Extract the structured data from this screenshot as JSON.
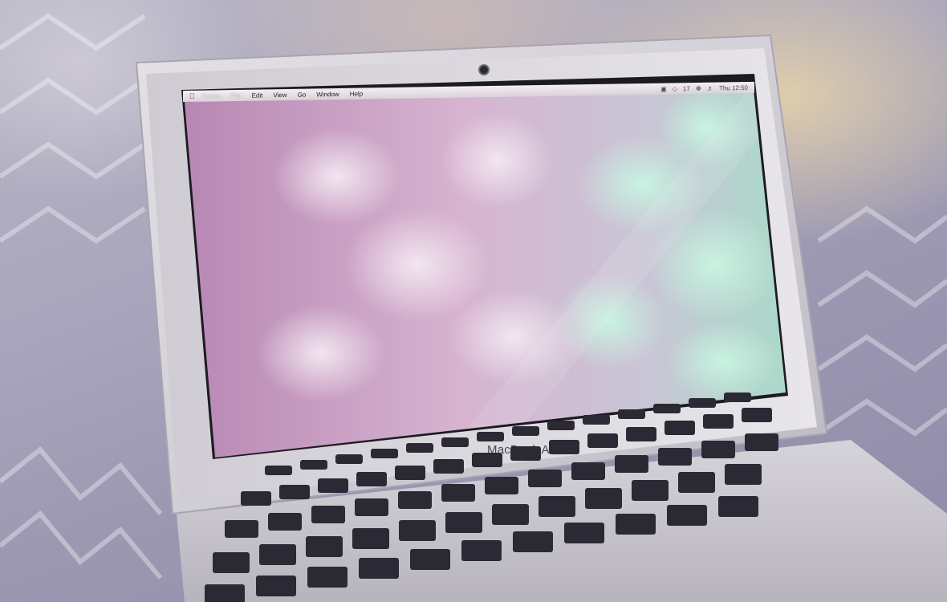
{
  "menubar": {
    "items": [
      "Edit",
      "View",
      "Go",
      "Window",
      "Help"
    ],
    "status_number": "17",
    "clock": "Thu 12:50"
  },
  "brand": "MacBook Air",
  "colors": {
    "wallpaper_pink": "#c79ac2",
    "wallpaper_mint": "#9fd9c2",
    "aluminum": "#d9d6dc",
    "keys": "#2b2933"
  }
}
